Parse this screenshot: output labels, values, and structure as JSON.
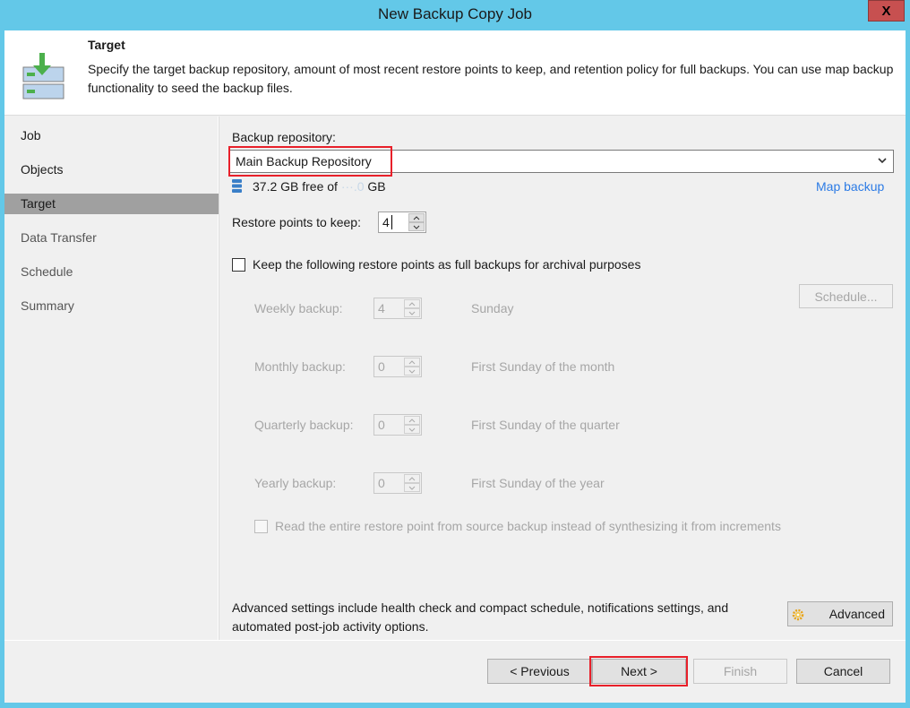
{
  "window": {
    "title": "New Backup Copy Job",
    "close_label": "X"
  },
  "header": {
    "title": "Target",
    "description": "Specify the target backup repository, amount of most recent restore points to keep, and retention policy for full backups. You can use map backup functionality to seed the backup files.",
    "icon": "backup-target-icon"
  },
  "sidebar": {
    "items": [
      {
        "label": "Job",
        "state": "done"
      },
      {
        "label": "Objects",
        "state": "done"
      },
      {
        "label": "Target",
        "state": "active"
      },
      {
        "label": "Data Transfer",
        "state": "pending"
      },
      {
        "label": "Schedule",
        "state": "pending"
      },
      {
        "label": "Summary",
        "state": "pending"
      }
    ]
  },
  "target": {
    "repository_label": "Backup repository:",
    "repository_value": "Main Backup Repository",
    "free_space_text": "37.2 GB free of ",
    "total_space_text": "···.0",
    "space_unit": " GB",
    "map_backup_link": "Map backup",
    "restore_points_label": "Restore points to keep:",
    "restore_points_value": "4",
    "archival_checkbox_label": "Keep the following restore points as full backups for archival purposes",
    "archival_checked": false,
    "schedule_button": "Schedule...",
    "gfs": [
      {
        "label": "Weekly backup:",
        "value": "4",
        "description": "Sunday"
      },
      {
        "label": "Monthly backup:",
        "value": "0",
        "description": "First Sunday of the month"
      },
      {
        "label": "Quarterly backup:",
        "value": "0",
        "description": "First Sunday of the quarter"
      },
      {
        "label": "Yearly backup:",
        "value": "0",
        "description": "First Sunday of the year"
      }
    ],
    "read_entire_label": "Read the entire restore point from source backup instead of synthesizing it from increments",
    "read_entire_checked": false,
    "advanced_text": "Advanced settings include health check and compact schedule, notifications settings, and automated post-job activity options.",
    "advanced_button": "Advanced"
  },
  "footer": {
    "previous": "< Previous",
    "next": "Next >",
    "finish": "Finish",
    "cancel": "Cancel"
  },
  "colors": {
    "frame": "#63c8e8",
    "highlight": "#e8202a",
    "link": "#2c7be5",
    "close": "#c75050"
  }
}
